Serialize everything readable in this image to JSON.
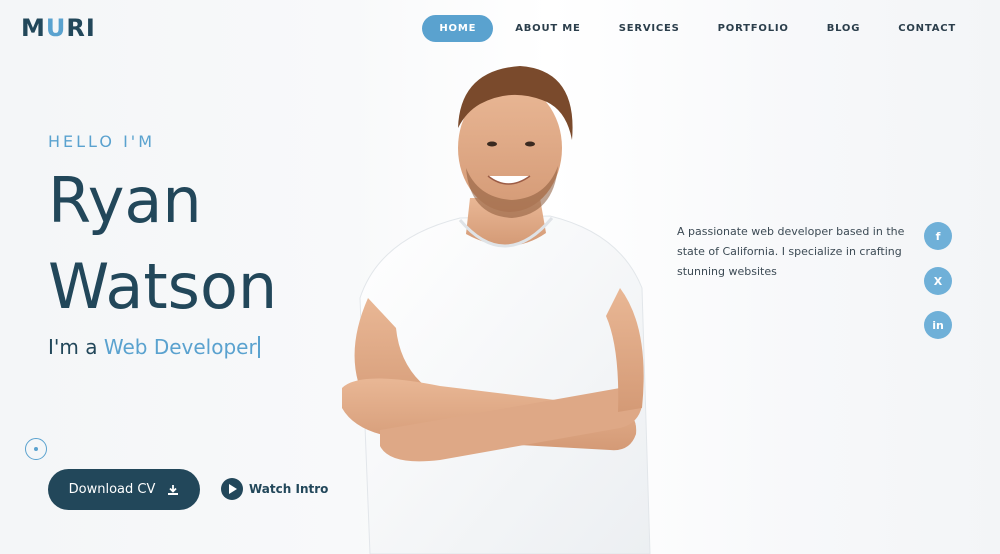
{
  "brand": {
    "logo_prefix": "M",
    "logo_accent": "U",
    "logo_suffix": "RI",
    "accent_color": "#5aa2cf",
    "primary_color": "#22475a"
  },
  "nav": {
    "items": [
      {
        "label": "HOME",
        "active": true
      },
      {
        "label": "ABOUT ME",
        "active": false
      },
      {
        "label": "SERVICES",
        "active": false
      },
      {
        "label": "PORTFOLIO",
        "active": false
      },
      {
        "label": "BLOG",
        "active": false
      },
      {
        "label": "CONTACT",
        "active": false
      }
    ]
  },
  "hero": {
    "greeting": "HELLO I'M",
    "first_name": "Ryan",
    "last_name": "Watson",
    "role_prefix": "I'm a ",
    "role_highlight": "Web Developer",
    "download_label": "Download CV",
    "watch_label": "Watch Intro"
  },
  "bio": {
    "text": "A passionate web developer based in the state of California. I specialize in crafting stunning websites"
  },
  "social": [
    {
      "icon": "facebook-icon",
      "glyph": "f"
    },
    {
      "icon": "x-twitter-icon",
      "glyph": "X"
    },
    {
      "icon": "linkedin-icon",
      "glyph": "in"
    }
  ]
}
